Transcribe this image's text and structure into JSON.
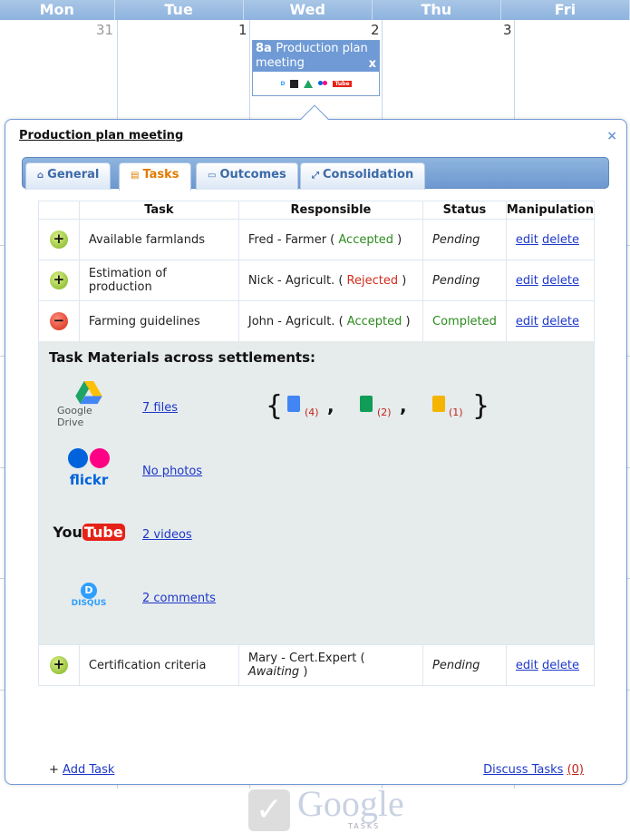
{
  "calendar": {
    "days": [
      "Mon",
      "Tue",
      "Wed",
      "Thu",
      "Fri"
    ],
    "dates": [
      "31",
      "1",
      "2",
      "3"
    ],
    "event": {
      "time": "8a",
      "title": "Production plan meeting",
      "close": "x"
    }
  },
  "popup": {
    "title": "Production plan meeting",
    "close": "×",
    "tabs": [
      {
        "label": "General",
        "icon": "home-icon"
      },
      {
        "label": "Tasks",
        "icon": "task-icon",
        "active": true
      },
      {
        "label": "Outcomes",
        "icon": "folder-icon"
      },
      {
        "label": "Consolidation",
        "icon": "expand-icon"
      }
    ],
    "table": {
      "headers": [
        "Task",
        "Responsible",
        "Status",
        "Manipulation"
      ],
      "rows": [
        {
          "task": "Available farmlands",
          "resp": "Fred - Farmer",
          "resp_status": "Accepted",
          "status": "Pending",
          "edit": "edit",
          "del": "delete",
          "icon": "plus"
        },
        {
          "task": "Estimation of production",
          "resp": "Nick - Agricult.",
          "resp_status": "Rejected",
          "status": "Pending",
          "edit": "edit",
          "del": "delete",
          "icon": "plus"
        },
        {
          "task": "Farming guidelines",
          "resp": "John - Agricult.",
          "resp_status": "Accepted",
          "status": "Completed",
          "edit": "edit",
          "del": "delete",
          "icon": "minus"
        },
        {
          "task": "Certification criteria",
          "resp": "Mary - Cert.Expert",
          "resp_status": "Awaiting",
          "status": "Pending",
          "edit": "edit",
          "del": "delete",
          "icon": "plus"
        }
      ]
    },
    "materials": {
      "heading": "Task Materials across settlements:",
      "drive": {
        "label": "Google Drive",
        "link": "7 files",
        "docs": "(4)",
        "sheets": "(2)",
        "slides": "(1)"
      },
      "flickr": {
        "label": "flickr",
        "link": "No photos"
      },
      "youtube": {
        "label_you": "You",
        "label_tube": "Tube",
        "link": "2 videos"
      },
      "disqus": {
        "label": "DISQUS",
        "letter": "D",
        "link": "2 comments"
      }
    },
    "footer": {
      "add_prefix": "+",
      "add": "Add Task",
      "discuss": "Discuss Tasks",
      "discuss_count": "(0)"
    },
    "logo": {
      "word": "Google",
      "sub": "TASKS"
    }
  }
}
